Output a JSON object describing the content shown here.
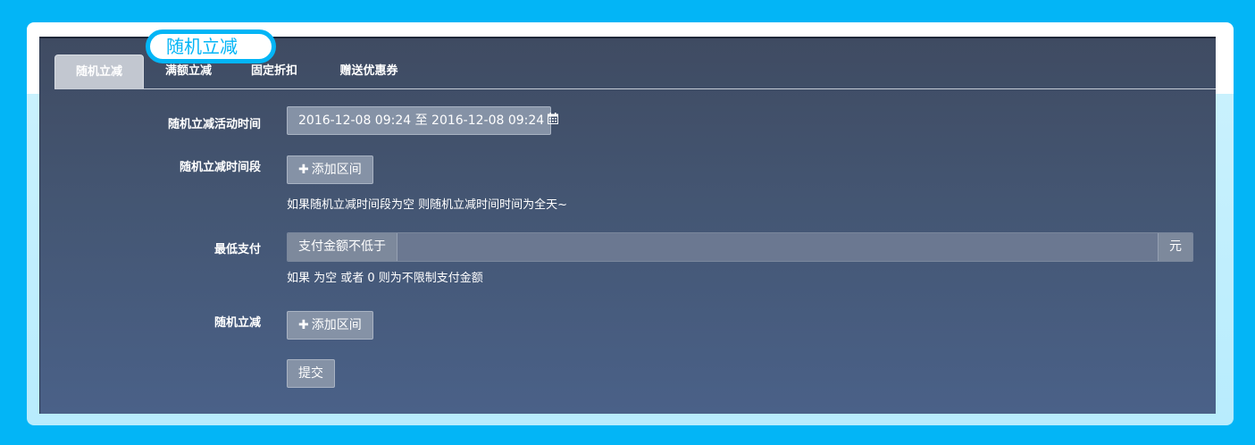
{
  "tabs": [
    {
      "label": "随机立减"
    },
    {
      "label": "满额立减"
    },
    {
      "label": "固定折扣"
    },
    {
      "label": "赠送优惠券"
    }
  ],
  "bubble": {
    "label": "随机立减"
  },
  "form": {
    "activity_time_label": "随机立减活动时间",
    "activity_time_value": "2016-12-08 09:24 至 2016-12-08 09:24",
    "time_slot_label": "随机立减时间段",
    "add_range_label": "添加区间",
    "time_slot_help": "如果随机立减时间段为空 则随机立减时间时间为全天~",
    "min_pay_label": "最低支付",
    "min_pay_prefix": "支付金额不低于",
    "min_pay_value": "",
    "min_pay_suffix": "元",
    "min_pay_help": "如果 为空 或者 0 则为不限制支付金额",
    "random_discount_label": "随机立减",
    "add_range_label_2": "添加区间",
    "submit_label": "提交"
  },
  "icons": {
    "calendar": "calendar-icon",
    "plus": "plus-icon"
  }
}
